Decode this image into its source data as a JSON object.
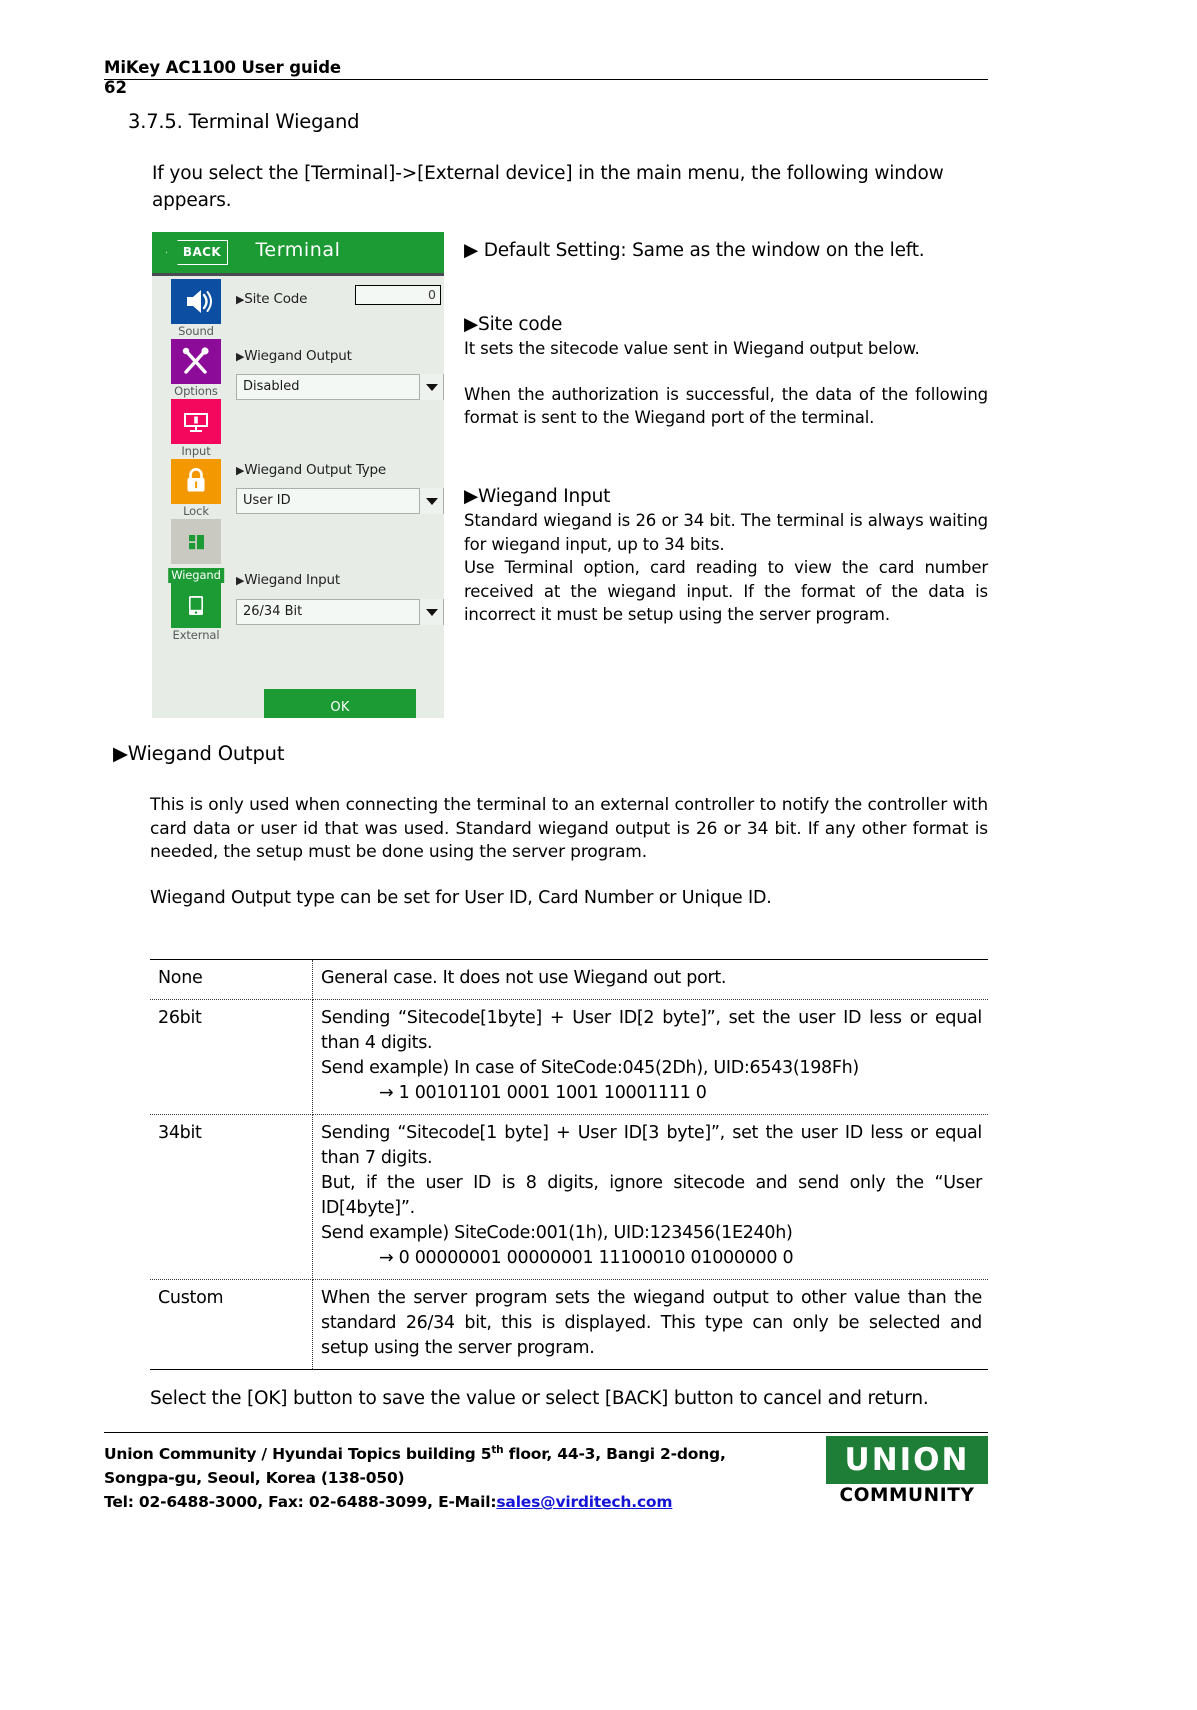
{
  "header": {
    "title": "MiKey AC1100 User guide",
    "page_number": "62"
  },
  "section": {
    "heading": "3.7.5. Terminal Wiegand",
    "intro": "If you select the [Terminal]->[External device] in the main menu, the following window appears."
  },
  "device": {
    "back_label": "BACK",
    "title": "Terminal",
    "rail": [
      {
        "label": "Sound",
        "icon": "speaker-icon",
        "color": "#0b4ea2",
        "selected": false
      },
      {
        "label": "Options",
        "icon": "wrench-icon",
        "color": "#8c0b99",
        "selected": false
      },
      {
        "label": "Input",
        "icon": "keypad-icon",
        "color": "#f4085e",
        "selected": false
      },
      {
        "label": "Lock",
        "icon": "padlock-icon",
        "color": "#f39800",
        "selected": false
      },
      {
        "label": "Wiegand",
        "icon": "wiegand-icon",
        "color": "#c9c9c2",
        "selected": true
      },
      {
        "label": "External",
        "icon": "terminal-icon",
        "color": "#1c9a34",
        "selected": false
      }
    ],
    "fields": {
      "site_code_label": "Site Code",
      "site_code_value": "0",
      "wiegand_output_label": "Wiegand Output",
      "wiegand_output_value": "Disabled",
      "wiegand_output_type_label": "Wiegand Output Type",
      "wiegand_output_type_value": "User ID",
      "wiegand_input_label": "Wiegand Input",
      "wiegand_input_value": "26/34 Bit"
    },
    "ok_label": "OK",
    "colors": {
      "title_bar": "#1c9a34",
      "body": "#e7ece6",
      "ok_button": "#1c9a34"
    }
  },
  "right_column": {
    "default_setting": "▶ Default Setting: Same as the window on the left.",
    "site_code_head": "▶Site code",
    "site_code_body": "It sets the sitecode value sent in Wiegand output below.",
    "site_code_body2": "When the authorization is successful, the data of the following format is sent to the Wiegand port of the terminal.",
    "wiegand_input_head": "▶Wiegand Input",
    "wiegand_input_body1": "Standard wiegand is 26 or 34 bit. The terminal is always waiting for wiegand input, up to 34 bits.",
    "wiegand_input_body2": "Use Terminal option, card reading to view the card number received at the wiegand input. If the format of the data is incorrect it must be setup using the server program."
  },
  "wiegand_output": {
    "heading": "▶Wiegand Output",
    "paragraph1": "This is only used when connecting the terminal to an external controller to notify the controller with card data or user id that was used. Standard wiegand output is 26 or 34 bit. If any other format is needed, the setup must be done using the server program.",
    "paragraph2": "Wiegand Output type can be set for User ID, Card Number or Unique ID."
  },
  "table": {
    "rows": [
      {
        "name": "None",
        "lines": [
          {
            "text": "General case.   It does not use Wiegand out port.",
            "indent": false
          }
        ]
      },
      {
        "name": "26bit",
        "lines": [
          {
            "text": "Sending “Sitecode[1byte] + User ID[2 byte]”, set the user ID less or equal than 4 digits.",
            "indent": false
          },
          {
            "text": "Send example) In case of SiteCode:045(2Dh), UID:6543(198Fh)",
            "indent": false
          },
          {
            "text": "→ 1 00101101 0001 1001 10001111 0",
            "indent": true
          }
        ]
      },
      {
        "name": "34bit",
        "lines": [
          {
            "text": "Sending “Sitecode[1 byte] + User ID[3 byte]”, set the user ID less or equal than 7 digits.",
            "indent": false
          },
          {
            "text": "But, if the user ID is 8 digits, ignore sitecode and send only the “User ID[4byte]”.",
            "indent": false
          },
          {
            "text": "Send example) SiteCode:001(1h), UID:123456(1E240h)",
            "indent": false
          },
          {
            "text": "→ 0 00000001 00000001 11100010 01000000 0",
            "indent": true
          }
        ]
      },
      {
        "name": "Custom",
        "lines": [
          {
            "text": "When the server program sets the wiegand output to other value than the standard 26/34 bit, this is displayed. This type can only be selected and setup using the server program.",
            "indent": false
          }
        ]
      }
    ]
  },
  "closing": "Select the [OK] button to save the value or select [BACK] button to cancel and return.",
  "footer": {
    "line1_a": "Union Community / Hyundai Topics building 5",
    "line1_sup": "th",
    "line1_b": " floor, 44-3, Bangi 2-dong,",
    "line2": "Songpa-gu, Seoul, Korea (138-050)",
    "line3_a": "Tel: 02-6488-3000, Fax: 02-6488-3099, E-Mail:",
    "line3_mail": "sales@virditech.com",
    "logo_mark": "UNION",
    "logo_word": "COMMUNITY",
    "logo_color": "#1e7d36"
  }
}
